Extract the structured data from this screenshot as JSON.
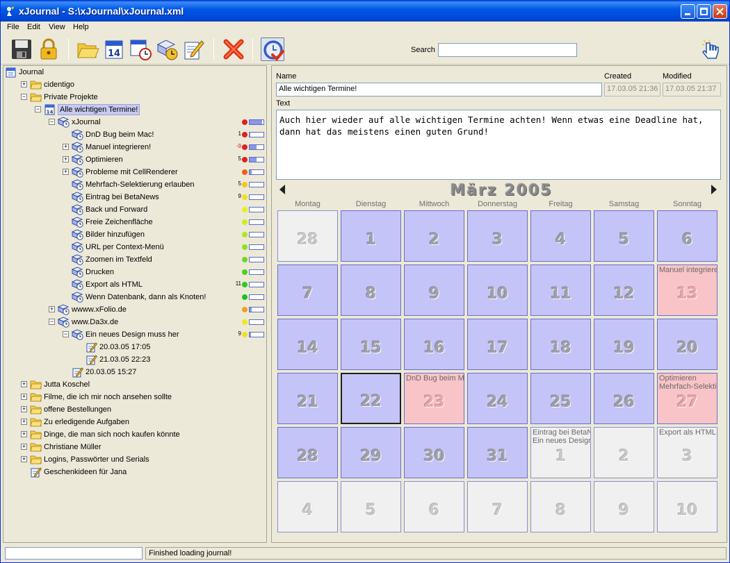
{
  "window": {
    "title": "xJournal - S:\\xJournal\\xJournal.xml"
  },
  "menu": [
    "File",
    "Edit",
    "View",
    "Help"
  ],
  "search": {
    "label": "Search",
    "value": ""
  },
  "tree": [
    {
      "label": "Journal",
      "level": 0,
      "icon": "journal-icon"
    },
    {
      "label": "cidentigo",
      "level": 1,
      "icon": "folder-icon",
      "exp": "+"
    },
    {
      "label": "Private Projekte",
      "level": 1,
      "icon": "folder-icon",
      "exp": "-"
    },
    {
      "label": "Alle wichtigen Termine!",
      "level": 2,
      "icon": "calendar-icon",
      "exp": "-",
      "selected": true
    },
    {
      "label": "xJournal",
      "level": 3,
      "icon": "task-icon",
      "exp": "-",
      "dot": "#e02020",
      "progress": 0.9
    },
    {
      "label": "DnD Bug beim Mac!",
      "level": 4,
      "icon": "task-icon",
      "num": "1",
      "dot": "#e02020",
      "progress": 0.05
    },
    {
      "label": "Manuel integrieren!",
      "level": 4,
      "icon": "task-icon",
      "exp": "+",
      "num": "-9",
      "dot": "#e02020",
      "progress": 0.5
    },
    {
      "label": "Optimieren",
      "level": 4,
      "icon": "task-icon",
      "exp": "+",
      "num": "5",
      "dot": "#e02020",
      "progress": 0.5
    },
    {
      "label": "Probleme mit CellRenderer",
      "level": 4,
      "icon": "task-icon",
      "exp": "+",
      "dot": "#f06018",
      "progress": 0.15
    },
    {
      "label": "Mehrfach-Selektierung erlauben",
      "level": 4,
      "icon": "task-icon",
      "num": "5",
      "dot": "#f0c820",
      "progress": 0.0
    },
    {
      "label": "Eintrag bei BetaNews",
      "level": 4,
      "icon": "task-icon",
      "num": "9",
      "dot": "#f0e020",
      "progress": 0.0
    },
    {
      "label": "Back und Forward",
      "level": 4,
      "icon": "task-icon",
      "dot": "#e8f020",
      "progress": 0.0
    },
    {
      "label": "Freie Zeichenfläche",
      "level": 4,
      "icon": "task-icon",
      "dot": "#c8f020",
      "progress": 0.0
    },
    {
      "label": "Bilder hinzufügen",
      "level": 4,
      "icon": "task-icon",
      "dot": "#b0e820",
      "progress": 0.0
    },
    {
      "label": "URL per Context-Menü",
      "level": 4,
      "icon": "task-icon",
      "dot": "#90e020",
      "progress": 0.0
    },
    {
      "label": "Zoomen im Textfeld",
      "level": 4,
      "icon": "task-icon",
      "dot": "#70d820",
      "progress": 0.0
    },
    {
      "label": "Drucken",
      "level": 4,
      "icon": "task-icon",
      "dot": "#50d020",
      "progress": 0.0
    },
    {
      "label": "Export als HTML",
      "level": 4,
      "icon": "task-icon",
      "num": "11",
      "dot": "#30c820",
      "progress": 0.0
    },
    {
      "label": "Wenn Datenbank, dann als Knoten!",
      "level": 4,
      "icon": "task-icon",
      "dot": "#20c020",
      "progress": 0.0
    },
    {
      "label": "wwww.xFolio.de",
      "level": 3,
      "icon": "task-icon",
      "exp": "+",
      "dot": "#f0a020",
      "progress": 0.15
    },
    {
      "label": "www.Da3x.de",
      "level": 3,
      "icon": "task-icon",
      "exp": "-",
      "dot": "#f0e820",
      "progress": 0.0
    },
    {
      "label": "Ein neues Design muss her",
      "level": 4,
      "icon": "task-icon",
      "exp": "-",
      "num": "9",
      "dot": "#f0e020",
      "progress": 0.1
    },
    {
      "label": "20.03.05 17:05",
      "level": 5,
      "icon": "note-icon"
    },
    {
      "label": "21.03.05 22:23",
      "level": 5,
      "icon": "note-icon"
    },
    {
      "label": "20.03.05 15:27",
      "level": 4,
      "icon": "note-icon"
    },
    {
      "label": "Jutta Koschel",
      "level": 1,
      "icon": "folder-icon",
      "exp": "+"
    },
    {
      "label": "Filme, die ich mir noch ansehen sollte",
      "level": 1,
      "icon": "folder-icon",
      "exp": "+"
    },
    {
      "label": "offene Bestellungen",
      "level": 1,
      "icon": "folder-icon",
      "exp": "+"
    },
    {
      "label": "Zu erledigende Aufgaben",
      "level": 1,
      "icon": "folder-icon",
      "exp": "+"
    },
    {
      "label": "Dinge, die man sich noch kaufen könnte",
      "level": 1,
      "icon": "folder-icon",
      "exp": "+"
    },
    {
      "label": "Christiane Müller",
      "level": 1,
      "icon": "folder-icon",
      "exp": "+"
    },
    {
      "label": "Logins, Passwörter und Serials",
      "level": 1,
      "icon": "folder-icon",
      "exp": "+"
    },
    {
      "label": "Geschenkideen für Jana",
      "level": 1,
      "icon": "note-icon"
    }
  ],
  "detail": {
    "name_label": "Name",
    "name_value": "Alle wichtigen Termine!",
    "created_label": "Created",
    "created_value": "17.03.05 21:36",
    "modified_label": "Modified",
    "modified_value": "17.03.05 21:37",
    "text_label": "Text",
    "text_value": "Auch hier wieder auf alle wichtigen Termine achten! Wenn etwas eine Deadline hat, dann hat das meistens einen guten Grund!"
  },
  "calendar": {
    "month_title": "März 2005",
    "day_names": [
      "Montag",
      "Dienstag",
      "Mittwoch",
      "Donnerstag",
      "Freitag",
      "Samstag",
      "Sonntag"
    ],
    "weeks": [
      [
        {
          "d": "28",
          "t": "other"
        },
        {
          "d": "1",
          "t": "cur"
        },
        {
          "d": "2",
          "t": "cur"
        },
        {
          "d": "3",
          "t": "cur"
        },
        {
          "d": "4",
          "t": "cur"
        },
        {
          "d": "5",
          "t": "cur"
        },
        {
          "d": "6",
          "t": "cur"
        }
      ],
      [
        {
          "d": "7",
          "t": "cur"
        },
        {
          "d": "8",
          "t": "cur"
        },
        {
          "d": "9",
          "t": "cur"
        },
        {
          "d": "10",
          "t": "cur"
        },
        {
          "d": "11",
          "t": "cur"
        },
        {
          "d": "12",
          "t": "cur"
        },
        {
          "d": "13",
          "t": "event",
          "ev": [
            "Manuel integrieren!"
          ]
        }
      ],
      [
        {
          "d": "14",
          "t": "cur"
        },
        {
          "d": "15",
          "t": "cur"
        },
        {
          "d": "16",
          "t": "cur"
        },
        {
          "d": "17",
          "t": "cur"
        },
        {
          "d": "18",
          "t": "cur"
        },
        {
          "d": "19",
          "t": "cur"
        },
        {
          "d": "20",
          "t": "cur"
        }
      ],
      [
        {
          "d": "21",
          "t": "cur"
        },
        {
          "d": "22",
          "t": "cur",
          "today": true
        },
        {
          "d": "23",
          "t": "event",
          "ev": [
            "DnD Bug beim Mac!"
          ]
        },
        {
          "d": "24",
          "t": "cur"
        },
        {
          "d": "25",
          "t": "cur"
        },
        {
          "d": "26",
          "t": "cur"
        },
        {
          "d": "27",
          "t": "event",
          "ev": [
            "Optimieren",
            "Mehrfach-Selektierung erlauben"
          ]
        }
      ],
      [
        {
          "d": "28",
          "t": "cur"
        },
        {
          "d": "29",
          "t": "cur"
        },
        {
          "d": "30",
          "t": "cur"
        },
        {
          "d": "31",
          "t": "cur"
        },
        {
          "d": "1",
          "t": "other",
          "ev": [
            "Eintrag bei BetaNews",
            "Ein neues Design muss her"
          ]
        },
        {
          "d": "2",
          "t": "other"
        },
        {
          "d": "3",
          "t": "other",
          "ev": [
            "Export als HTML"
          ]
        }
      ],
      [
        {
          "d": "4",
          "t": "other"
        },
        {
          "d": "5",
          "t": "other"
        },
        {
          "d": "6",
          "t": "other"
        },
        {
          "d": "7",
          "t": "other"
        },
        {
          "d": "8",
          "t": "other"
        },
        {
          "d": "9",
          "t": "other"
        },
        {
          "d": "10",
          "t": "other"
        }
      ]
    ]
  },
  "status": {
    "message": "Finished loading journal!"
  },
  "toolbar_icons": [
    "save-icon",
    "lock-icon",
    "open-folder-icon",
    "calendar-icon",
    "calendar-clock-icon",
    "task-clock-icon",
    "edit-note-icon",
    "delete-icon",
    "check-clock-icon",
    "pointer-hand-icon"
  ]
}
